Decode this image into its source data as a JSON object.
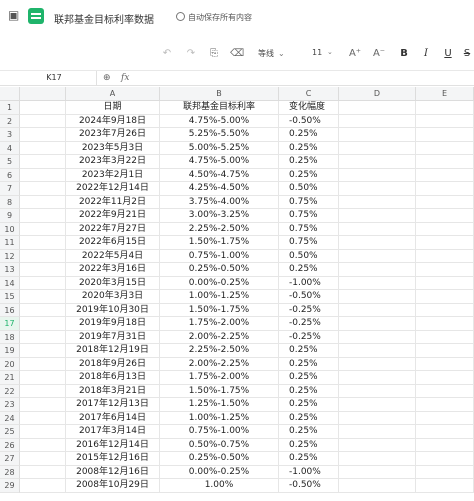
{
  "app": {
    "doc_title": "联邦基金目标利率数据",
    "autosave": "自动保存所有内容"
  },
  "toolbar": {
    "undo": "↶",
    "redo": "↷",
    "format_painter": "⎘",
    "clear": "⌫",
    "font": "等线",
    "size": "11",
    "grow": "A⁺",
    "shrink": "A⁻",
    "bold": "B",
    "italic": "I",
    "underline": "U",
    "strike": "S"
  },
  "formula_bar": {
    "cell_ref": "K17",
    "zoom_icon": "⊕",
    "fx": "fx"
  },
  "columns": [
    "A",
    "B",
    "C",
    "D",
    "E"
  ],
  "active_row": 17,
  "rows": [
    [
      "日期",
      "联邦基金目标利率",
      "变化幅度"
    ],
    [
      "2024年9月18日",
      "4.75%-5.00%",
      "-0.50%"
    ],
    [
      "2023年7月26日",
      "5.25%-5.50%",
      "0.25%"
    ],
    [
      "2023年5月3日",
      "5.00%-5.25%",
      "0.25%"
    ],
    [
      "2023年3月22日",
      "4.75%-5.00%",
      "0.25%"
    ],
    [
      "2023年2月1日",
      "4.50%-4.75%",
      "0.25%"
    ],
    [
      "2022年12月14日",
      "4.25%-4.50%",
      "0.50%"
    ],
    [
      "2022年11月2日",
      "3.75%-4.00%",
      "0.75%"
    ],
    [
      "2022年9月21日",
      "3.00%-3.25%",
      "0.75%"
    ],
    [
      "2022年7月27日",
      "2.25%-2.50%",
      "0.75%"
    ],
    [
      "2022年6月15日",
      "1.50%-1.75%",
      "0.75%"
    ],
    [
      "2022年5月4日",
      "0.75%-1.00%",
      "0.50%"
    ],
    [
      "2022年3月16日",
      "0.25%-0.50%",
      "0.25%"
    ],
    [
      "2020年3月15日",
      "0.00%-0.25%",
      "-1.00%"
    ],
    [
      "2020年3月3日",
      "1.00%-1.25%",
      "-0.50%"
    ],
    [
      "2019年10月30日",
      "1.50%-1.75%",
      "-0.25%"
    ],
    [
      "2019年9月18日",
      "1.75%-2.00%",
      "-0.25%"
    ],
    [
      "2019年7月31日",
      "2.00%-2.25%",
      "-0.25%"
    ],
    [
      "2018年12月19日",
      "2.25%-2.50%",
      "0.25%"
    ],
    [
      "2018年9月26日",
      "2.00%-2.25%",
      "0.25%"
    ],
    [
      "2018年6月13日",
      "1.75%-2.00%",
      "0.25%"
    ],
    [
      "2018年3月21日",
      "1.50%-1.75%",
      "0.25%"
    ],
    [
      "2017年12月13日",
      "1.25%-1.50%",
      "0.25%"
    ],
    [
      "2017年6月14日",
      "1.00%-1.25%",
      "0.25%"
    ],
    [
      "2017年3月14日",
      "0.75%-1.00%",
      "0.25%"
    ],
    [
      "2016年12月14日",
      "0.50%-0.75%",
      "0.25%"
    ],
    [
      "2015年12月16日",
      "0.25%-0.50%",
      "0.25%"
    ],
    [
      "2008年12月16日",
      "0.00%-0.25%",
      "-1.00%"
    ],
    [
      "2008年10月29日",
      "1.00%",
      "-0.50%"
    ]
  ]
}
